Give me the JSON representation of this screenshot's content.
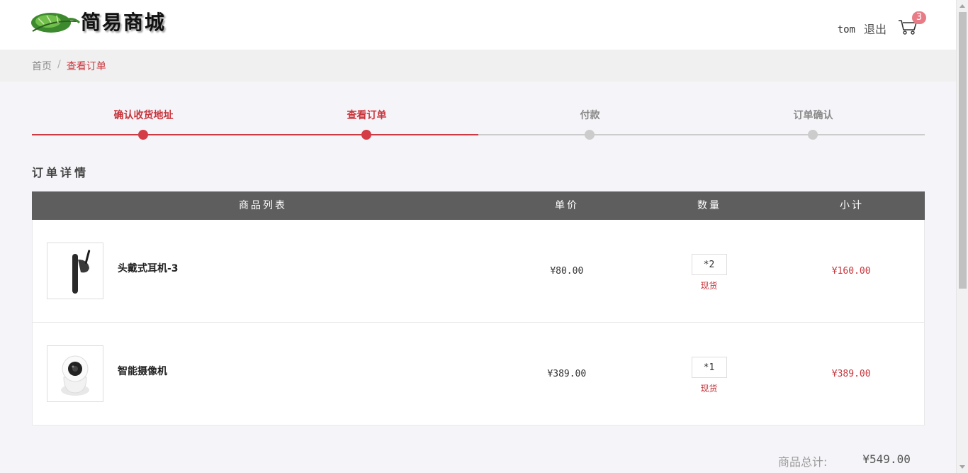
{
  "header": {
    "logo_text": "简易商城",
    "username": "tom",
    "logout_label": "退出",
    "cart_count": "3"
  },
  "breadcrumb": {
    "home": "首页",
    "separator": "/",
    "current": "查看订单"
  },
  "steps": [
    {
      "label": "确认收货地址",
      "status": "done"
    },
    {
      "label": "查看订单",
      "status": "done"
    },
    {
      "label": "付款",
      "status": "pending"
    },
    {
      "label": "订单确认",
      "status": "pending"
    }
  ],
  "order": {
    "title": "订单详情",
    "columns": [
      "商品列表",
      "单价",
      "数量",
      "小计"
    ],
    "items": [
      {
        "name": "头戴式耳机-3",
        "price": "¥80.00",
        "qty": "*2",
        "stock": "现货",
        "subtotal": "¥160.00",
        "icon": "earphone-icon"
      },
      {
        "name": "智能摄像机",
        "price": "¥389.00",
        "qty": "*1",
        "stock": "现货",
        "subtotal": "¥389.00",
        "icon": "camera-icon"
      }
    ],
    "total_label": "商品总计:",
    "total_value": "¥549.00"
  },
  "colors": {
    "accent": "#c8353c",
    "table_header": "#5e5e5e",
    "badge": "#e87c86"
  }
}
